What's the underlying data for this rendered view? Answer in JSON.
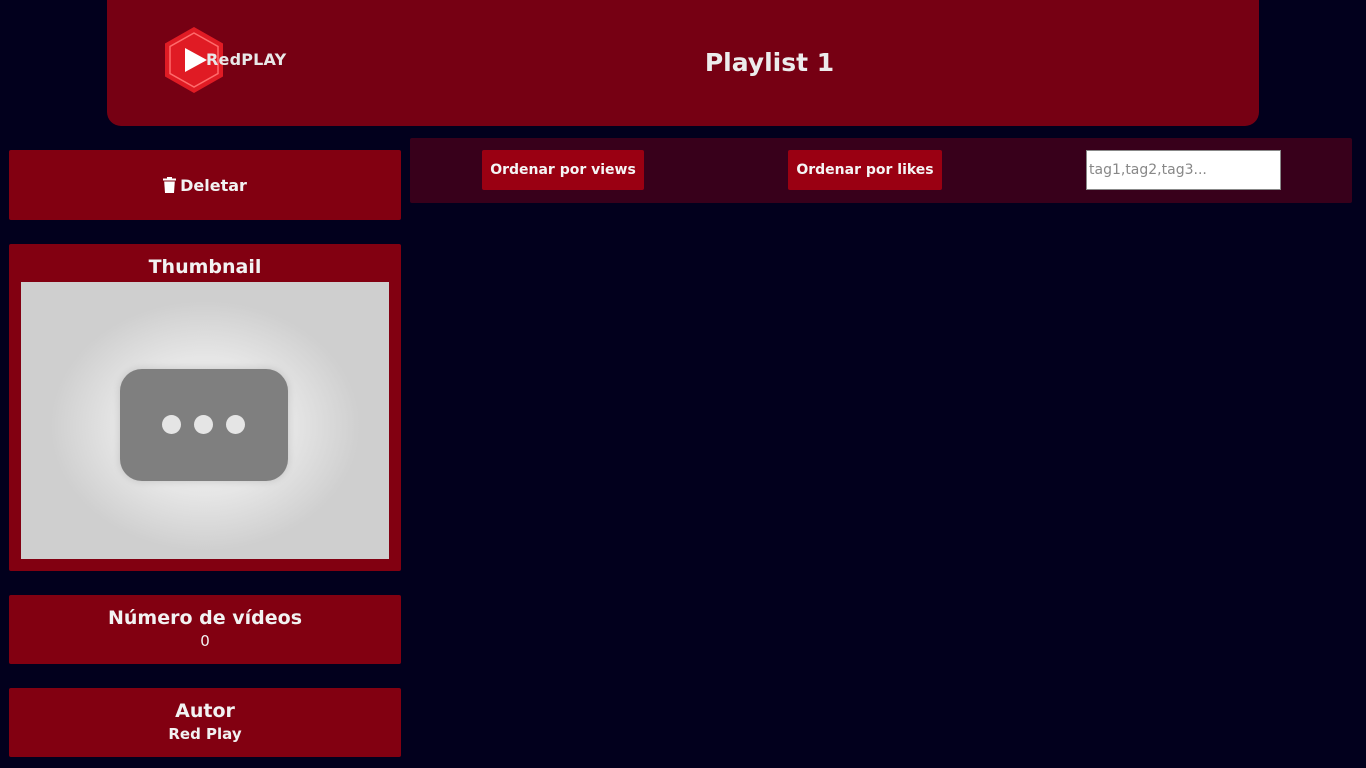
{
  "header": {
    "logo_text": "RedPLAY",
    "title": "Playlist 1"
  },
  "sidebar": {
    "delete_label": "Deletar",
    "thumbnail_heading": "Thumbnail",
    "videos_heading": "Número de vídeos",
    "videos_count": "0",
    "author_heading": "Autor",
    "author_name": "Red Play"
  },
  "toolbar": {
    "sort_views_label": "Ordenar por views",
    "sort_likes_label": "Ordenar por likes",
    "tags_placeholder": "tag1,tag2,tag3..."
  },
  "icons": {
    "logo": "play-hexagon-icon",
    "delete": "trash-icon",
    "thumbnail_placeholder": "ellipsis-video-icon"
  },
  "colors": {
    "background": "#02001d",
    "header": "#760013",
    "card": "#820011",
    "toolbar": "#38001b",
    "button": "#9a0012",
    "logo_red": "#e01b24"
  }
}
